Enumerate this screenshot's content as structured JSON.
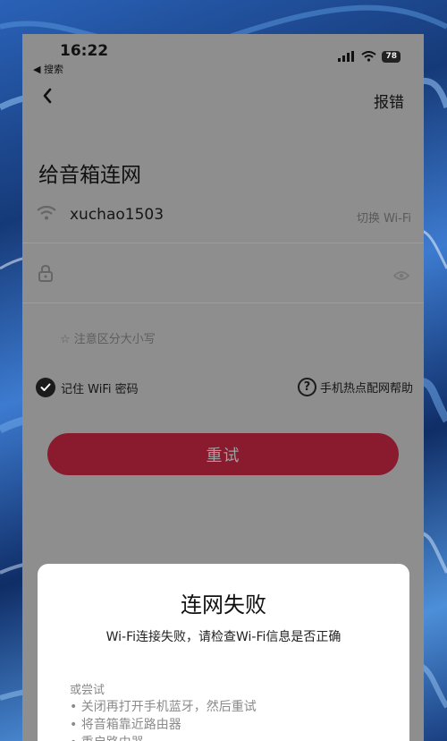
{
  "status_bar": {
    "time": "16:22",
    "back_app": "◀ 搜索",
    "battery": "78"
  },
  "nav": {
    "report": "报错"
  },
  "page": {
    "title": "给音箱连网"
  },
  "wifi": {
    "ssid": "xuchao1503",
    "switch_label": "切换 Wi-Fi"
  },
  "password": {
    "value": "",
    "placeholder": ""
  },
  "hint": "☆ 注意区分大小写",
  "remember": {
    "label": "记住 WiFi 密码",
    "checked": true
  },
  "help": {
    "label": "手机热点配网帮助"
  },
  "retry_button": {
    "label": "重试"
  },
  "dialog": {
    "title": "连网失败",
    "message": "Wi-Fi连接失败，请检查Wi-Fi信息是否正确",
    "tips_label": "或尝试",
    "tips": [
      "• 关闭再打开手机蓝牙，然后重试",
      "• 将音箱靠近路由器",
      "• 重启路由器"
    ]
  },
  "colors": {
    "accent": "#8a1a2e",
    "overlay": "#8e8e8e",
    "dialog_bg": "#ffffff"
  }
}
